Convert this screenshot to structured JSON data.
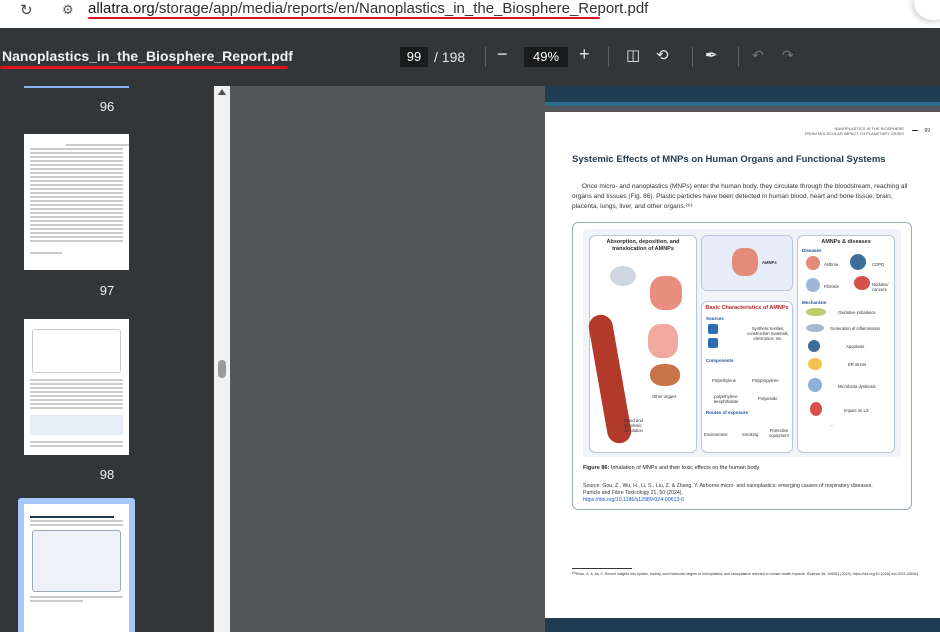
{
  "browser": {
    "url_host": "allatra.org",
    "url_path": "/storage/app/media/reports/en/Nanoplastics_in_the_Biosphere_Report.pdf"
  },
  "toolbar": {
    "title": "Nanoplastics_in_the_Biosphere_Report.pdf",
    "current_page": "99",
    "total_pages": "/ 198",
    "zoom": "49%",
    "zoom_out": "−",
    "zoom_in": "+"
  },
  "sidebar": {
    "thumbs": [
      {
        "label": "96"
      },
      {
        "label": "97"
      },
      {
        "label": "98"
      }
    ]
  },
  "page": {
    "running_head_1": "NANOPLASTICS IN THE BIOSPHERE",
    "running_head_2": "FROM MOLECULAR IMPACT TO PLANETARY CRISIS",
    "page_number": "99",
    "title": "Systemic Effects of MNPs on Human Organs and Functional Systems",
    "body": "Once micro- and nanoplastics (MNPs) enter the human body, they circulate through the bloodstream, reaching all organs and tissues (Fig. 86). Plastic particles have been detected in human blood, heart and bone tissue, brain, placenta, lungs, liver, and other organs.²⁶³",
    "figure": {
      "col1_title": "Absorption, deposition, and translocation of AMNPs",
      "col2_title": "AMNPs",
      "col2b_title": "Basic Characteristics of AMNPs",
      "col3_title": "AMNPs & diseases",
      "sources_h": "Sources",
      "sources_text": "Synthetic textiles, construction materials, electronics, etc.",
      "components_h": "Components",
      "polyethylene": "Polyethylene",
      "polypropylene": "Polypropylene",
      "pet": "polyethylene terephthalate",
      "polyamide": "Polyamide",
      "routes_h": "Routes of exposure",
      "environment": "Environment",
      "smoking": "Smoking",
      "protective": "Protective equipment",
      "other_organs": "Other organs",
      "blood": "Blood and lymphatic circulation",
      "diseases_h": "Diseases",
      "asthma": "Asthma",
      "copd": "COPD",
      "fibrosis": "Fibrosis",
      "nodules": "Nodules/ cancers",
      "mechanism_h": "Mechanism",
      "oxidative": "Oxidative imbalance",
      "inflammation": "Generation of inflammation",
      "apoptosis": "Apoptosis",
      "er_stress": "ER stress",
      "microbiota": "Microbiota dysbiosis",
      "impact_ls": "Impact on LS",
      "ellipsis": "...",
      "caption_bold": "Figure 86:",
      "caption": " Inhalation of MNPs and their toxic effects on the human body",
      "source": "Source: Gou, Z., Wu, H., Li, S., Liu, Z. & Zhang, Y. Airborne micro- and nanoplastics: emerging causes of respiratory diseases. Particle and Fibre Toxicology 21, 50 (2024).",
      "doi": "https://doi.org/10.1186/s12989-024-00613-6"
    },
    "footnote": "²⁶³Khan, A. & Jia, Z. Recent insights into uptake, toxicity, and molecular targets of microplastics and nanoplastics relevant to human health impacts. iScience 26, 106061 (2023). https://doi.org/10.1016/j.isci.2023.106061"
  }
}
